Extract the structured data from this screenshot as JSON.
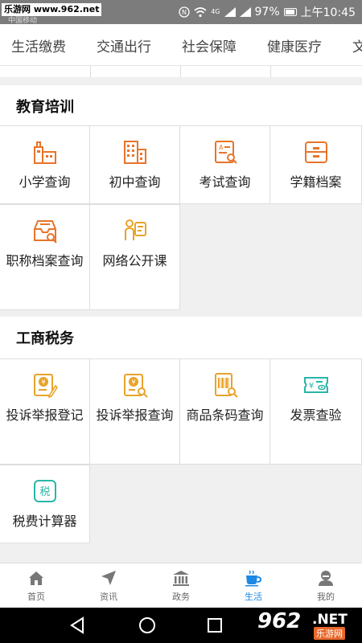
{
  "status_bar": {
    "watermark": "乐游网 www.962.net",
    "carrier": "中国移动",
    "network": "4G",
    "battery": "97%",
    "time": "上午10:45"
  },
  "tabs": [
    "生活缴费",
    "交通出行",
    "社会保障",
    "健康医疗",
    "文"
  ],
  "sections": [
    {
      "title": "教育培训",
      "items": [
        {
          "label": "小学查询",
          "icon": "school-building-icon"
        },
        {
          "label": "初中查询",
          "icon": "middle-school-building-icon"
        },
        {
          "label": "考试查询",
          "icon": "exam-search-icon"
        },
        {
          "label": "学籍档案",
          "icon": "student-file-icon"
        },
        {
          "label": "职称档案查询",
          "icon": "archive-search-icon"
        },
        {
          "label": "网络公开课",
          "icon": "online-course-icon"
        }
      ]
    },
    {
      "title": "工商税务",
      "items": [
        {
          "label": "投诉举报登记",
          "icon": "complaint-register-icon"
        },
        {
          "label": "投诉举报查询",
          "icon": "complaint-search-icon"
        },
        {
          "label": "商品条码查询",
          "icon": "barcode-search-icon"
        },
        {
          "label": "发票查验",
          "icon": "invoice-check-icon"
        },
        {
          "label": "税费计算器",
          "icon": "tax-calculator-icon"
        }
      ]
    }
  ],
  "tax_icon_text": "税",
  "colors": {
    "accent": "#e8742a",
    "active_nav": "#1e88e5",
    "teal": "#2bb5a8"
  },
  "bottom_nav": [
    {
      "label": "首页",
      "icon": "home-icon"
    },
    {
      "label": "资讯",
      "icon": "navigation-arrow-icon"
    },
    {
      "label": "政务",
      "icon": "government-building-icon"
    },
    {
      "label": "生活",
      "icon": "coffee-cup-icon",
      "active": true
    },
    {
      "label": "我的",
      "icon": "user-avatar-icon"
    }
  ],
  "watermark_logo": {
    "number": "962",
    "domain": ".NET",
    "name": "乐游网"
  }
}
